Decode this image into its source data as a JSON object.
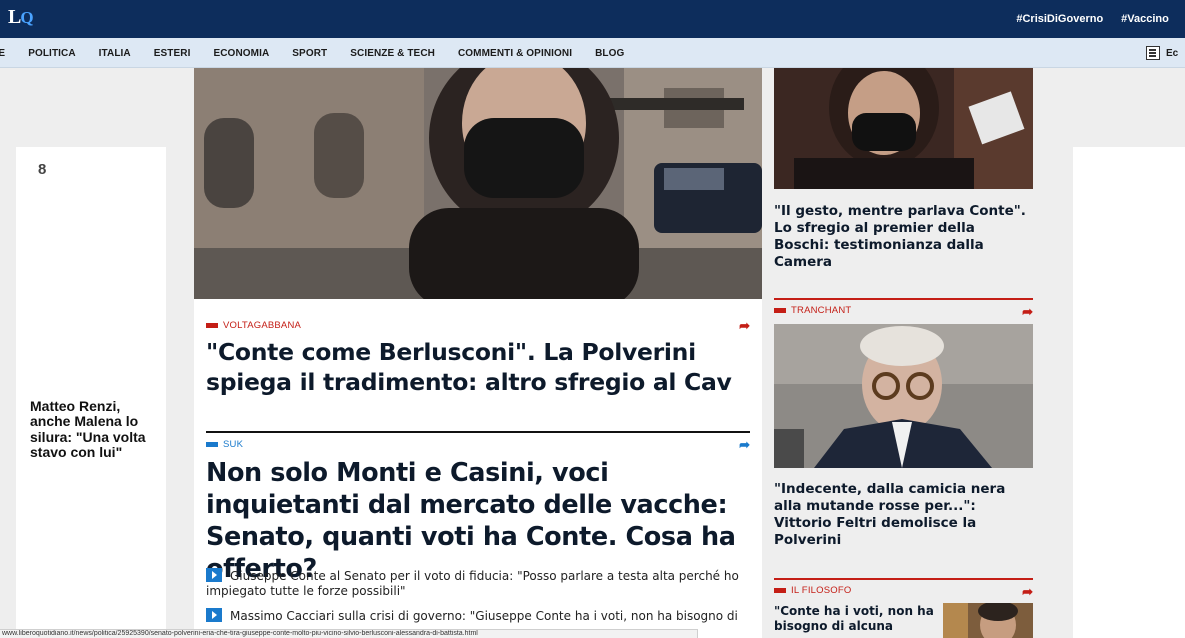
{
  "header": {
    "logo_text": "L",
    "logo_q": "Q",
    "trending_tags": [
      "#CrisiDiGoverno",
      "#Vaccino",
      "#"
    ]
  },
  "nav": {
    "items": [
      "ME",
      "POLITICA",
      "ITALIA",
      "ESTERI",
      "ECONOMIA",
      "SPORT",
      "SCIENZE & TECH",
      "COMMENTI & OPINIONI",
      "BLOG"
    ],
    "edicola_label": "Ec"
  },
  "left_card": {
    "number": "8",
    "title": "Matteo Renzi, anche Malena lo silura: \"Una volta stavo con lui\""
  },
  "main": {
    "article1": {
      "kicker": "VOLTAGABBANA",
      "headline": "\"Conte come Berlusconi\". La Polverini spiega il tradimento: altro sfregio al Cav"
    },
    "article2": {
      "kicker": "SUK",
      "headline": "Non solo Monti e Casini, voci inquietanti dal mercato delle vacche: Senato, quanti voti ha Conte. Cosa ha offerto?"
    },
    "related": [
      "Giuseppe Conte al Senato per il voto di fiducia: \"Posso parlare a testa alta perché ho impiegato tutte le forze possibili\"",
      "Massimo Cacciari sulla crisi di governo: \"Giuseppe Conte ha i voti, non ha bisogno di"
    ]
  },
  "right": {
    "story1_title": "\"Il gesto, mentre parlava Conte\". Lo sfregio al premier della Boschi: testimonianza dalla Camera",
    "section2_kicker": "TRANCHANT",
    "story2_title": "\"Indecente, dalla camicia nera alla mutande rosse per...\": Vittorio Feltri demolisce la Polverini",
    "section3_kicker": "IL FILOSOFO",
    "story3_title": "\"Conte ha i voti, non ha bisogno di alcuna"
  },
  "status_url": "www.liberoquotidiano.it/news/politica/25925390/senato-polverini-eria-che-tira-giuseppe-conte-molto-piu-vicino-silvio-berlusconi-alessandra-di-battista.html",
  "colors": {
    "topbar": "#0d2d5c",
    "navbar": "#dde8f4",
    "accent_red": "#c41e16",
    "accent_blue": "#1a7acc"
  }
}
